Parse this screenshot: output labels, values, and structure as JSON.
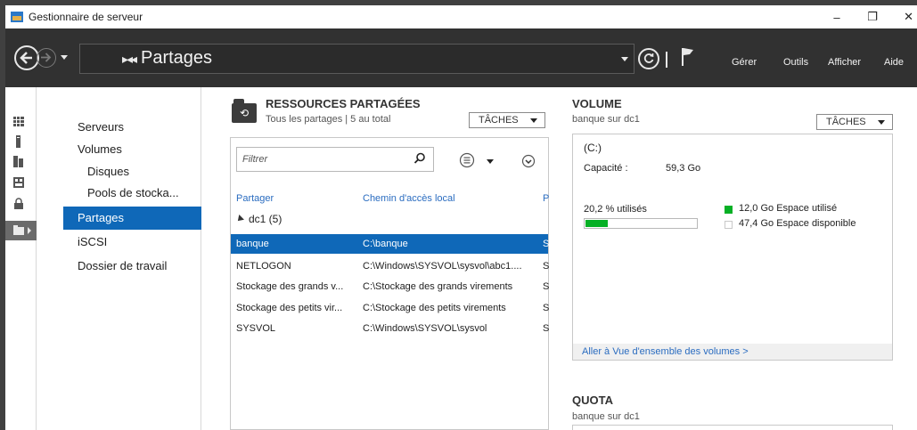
{
  "window": {
    "title": "Gestionnaire de serveur",
    "minimize": "–",
    "restore": "❐",
    "close": "✕"
  },
  "nav": {
    "breadcrumb_icon": "▸◂◂",
    "breadcrumb": "Partages",
    "menu": [
      "Gérer",
      "Outils",
      "Afficher",
      "Aide"
    ]
  },
  "sidebar": {
    "items": [
      {
        "label": "Serveurs",
        "sub": false,
        "active": false
      },
      {
        "label": "Volumes",
        "sub": false,
        "active": false
      },
      {
        "label": "Disques",
        "sub": true,
        "active": false
      },
      {
        "label": "Pools de stocka...",
        "sub": true,
        "active": false
      },
      {
        "label": "Partages",
        "sub": false,
        "active": true
      },
      {
        "label": "iSCSI",
        "sub": false,
        "active": false
      },
      {
        "label": "Dossier de travail",
        "sub": false,
        "active": false
      }
    ]
  },
  "shares": {
    "title": "RESSOURCES PARTAGÉES",
    "subtitle": "Tous les partages | 5 au total",
    "tasks_label": "TÂCHES",
    "filter_placeholder": "Filtrer",
    "columns": [
      "Partager",
      "Chemin d'accès local",
      "P"
    ],
    "group": "dc1 (5)",
    "rows": [
      {
        "name": "banque",
        "path": "C:\\banque",
        "p": "S",
        "selected": true
      },
      {
        "name": "NETLOGON",
        "path": "C:\\Windows\\SYSVOL\\sysvol\\abc1....",
        "p": "S",
        "selected": false
      },
      {
        "name": "Stockage des grands v...",
        "path": "C:\\Stockage des grands virements",
        "p": "S",
        "selected": false
      },
      {
        "name": "Stockage des petits vir...",
        "path": "C:\\Stockage des petits virements",
        "p": "S",
        "selected": false
      },
      {
        "name": "SYSVOL",
        "path": "C:\\Windows\\SYSVOL\\sysvol",
        "p": "S",
        "selected": false
      }
    ]
  },
  "volume": {
    "title": "VOLUME",
    "subtitle": "banque sur dc1",
    "tasks_label": "TÂCHES",
    "drive": "(C:)",
    "capacity_label": "Capacité :",
    "capacity_value": "59,3 Go",
    "used_pct_label": "20,2 % utilisés",
    "used_fraction": 0.202,
    "used_label": "12,0 Go Espace utilisé",
    "free_label": "47,4 Go Espace disponible",
    "used_color": "#06b025",
    "link": "Aller à Vue d'ensemble des volumes >"
  },
  "quota": {
    "title": "QUOTA",
    "subtitle": "banque sur dc1"
  },
  "colors": {
    "accent": "#0f68b8",
    "navbar": "#313131",
    "link": "#2a6cc0"
  }
}
